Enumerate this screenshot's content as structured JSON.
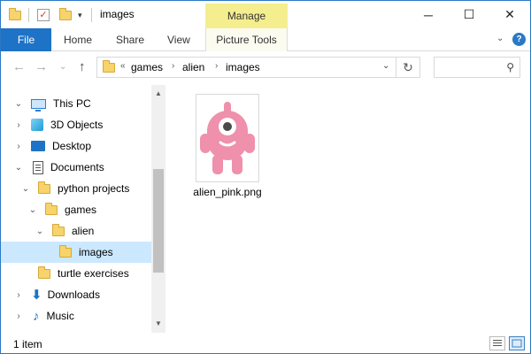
{
  "window": {
    "title": "images",
    "controls": {
      "minimize": "─",
      "maximize": "☐",
      "close": "✕"
    }
  },
  "quick_access": {
    "customize": "▾"
  },
  "ribbon": {
    "contextual_tab": "Manage",
    "tabs": {
      "file": "File",
      "home": "Home",
      "share": "Share",
      "view": "View",
      "picture_tools": "Picture Tools"
    },
    "expand": "⌄",
    "help": "?"
  },
  "address": {
    "overflow": "«",
    "crumbs": [
      "games",
      "alien",
      "images"
    ],
    "separator": "›",
    "dropdown": "⌄",
    "refresh": "↻",
    "search_placeholder": "",
    "search_icon": "⚲"
  },
  "nav_buttons": {
    "back": "←",
    "forward": "→",
    "recent": "⌄",
    "up": "↑"
  },
  "nav_pane": {
    "items": [
      {
        "label": "This PC",
        "twisty": "⌄",
        "icon": "pc-icon"
      },
      {
        "label": "3D Objects",
        "twisty": "›",
        "icon": "3d-objects-icon"
      },
      {
        "label": "Desktop",
        "twisty": "›",
        "icon": "desktop-icon"
      },
      {
        "label": "Documents",
        "twisty": "⌄",
        "icon": "documents-icon"
      },
      {
        "label": "python projects",
        "twisty": "⌄",
        "icon": "folder-icon"
      },
      {
        "label": "games",
        "twisty": "⌄",
        "icon": "folder-icon"
      },
      {
        "label": "alien",
        "twisty": "⌄",
        "icon": "folder-icon"
      },
      {
        "label": "images",
        "twisty": "",
        "icon": "folder-icon",
        "selected": true
      },
      {
        "label": "turtle exercises",
        "twisty": "",
        "icon": "folder-icon"
      },
      {
        "label": "Downloads",
        "twisty": "›",
        "icon": "downloads-icon"
      },
      {
        "label": "Music",
        "twisty": "›",
        "icon": "music-icon"
      }
    ]
  },
  "scrollbar": {
    "up": "▲",
    "down": "▼"
  },
  "files": [
    {
      "name": "alien_pink.png",
      "icon": "alien-pink-thumbnail"
    }
  ],
  "status": {
    "count": "1 item"
  },
  "colors": {
    "accent": "#1e73c6",
    "manage_tab": "#f4ee8f",
    "selection": "#cce8ff",
    "alien_pink": "#ef90ac"
  }
}
